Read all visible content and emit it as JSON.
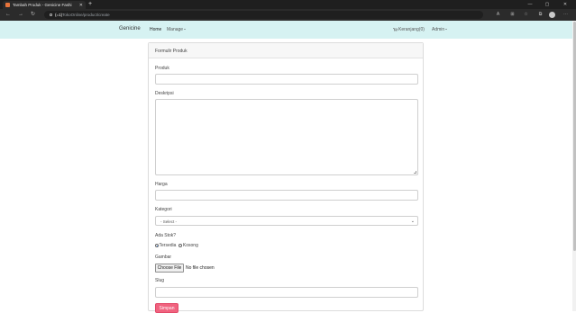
{
  "browser": {
    "tab_title": "Tambah Produk - Genicine Fashi",
    "url_scheme": "(=1)",
    "url_path": "TokoOnline/product/create"
  },
  "navbar": {
    "brand": "Genicine",
    "home": "Home",
    "manage": "Manage",
    "cart": "Keranjang(0)",
    "user": "Admin"
  },
  "form": {
    "header": "Formulir Produk",
    "produk_label": "Produk",
    "produk_value": "",
    "deskripsi_label": "Deskripsi",
    "harga_label": "Harga",
    "harga_value": "",
    "kategori_label": "Kategori",
    "kategori_selected": "- Select -",
    "stok_label": "Ada Stok?",
    "stok_options": [
      "Tersedia",
      "Kosong"
    ],
    "gambar_label": "Gambar",
    "file_button": "Choose File",
    "file_status": "No file chosen",
    "slug_label": "Slug",
    "slug_value": "",
    "submit": "Simpan"
  },
  "colors": {
    "navbar_bg": "#d6f2f2",
    "submit_bg": "#f0637f"
  }
}
